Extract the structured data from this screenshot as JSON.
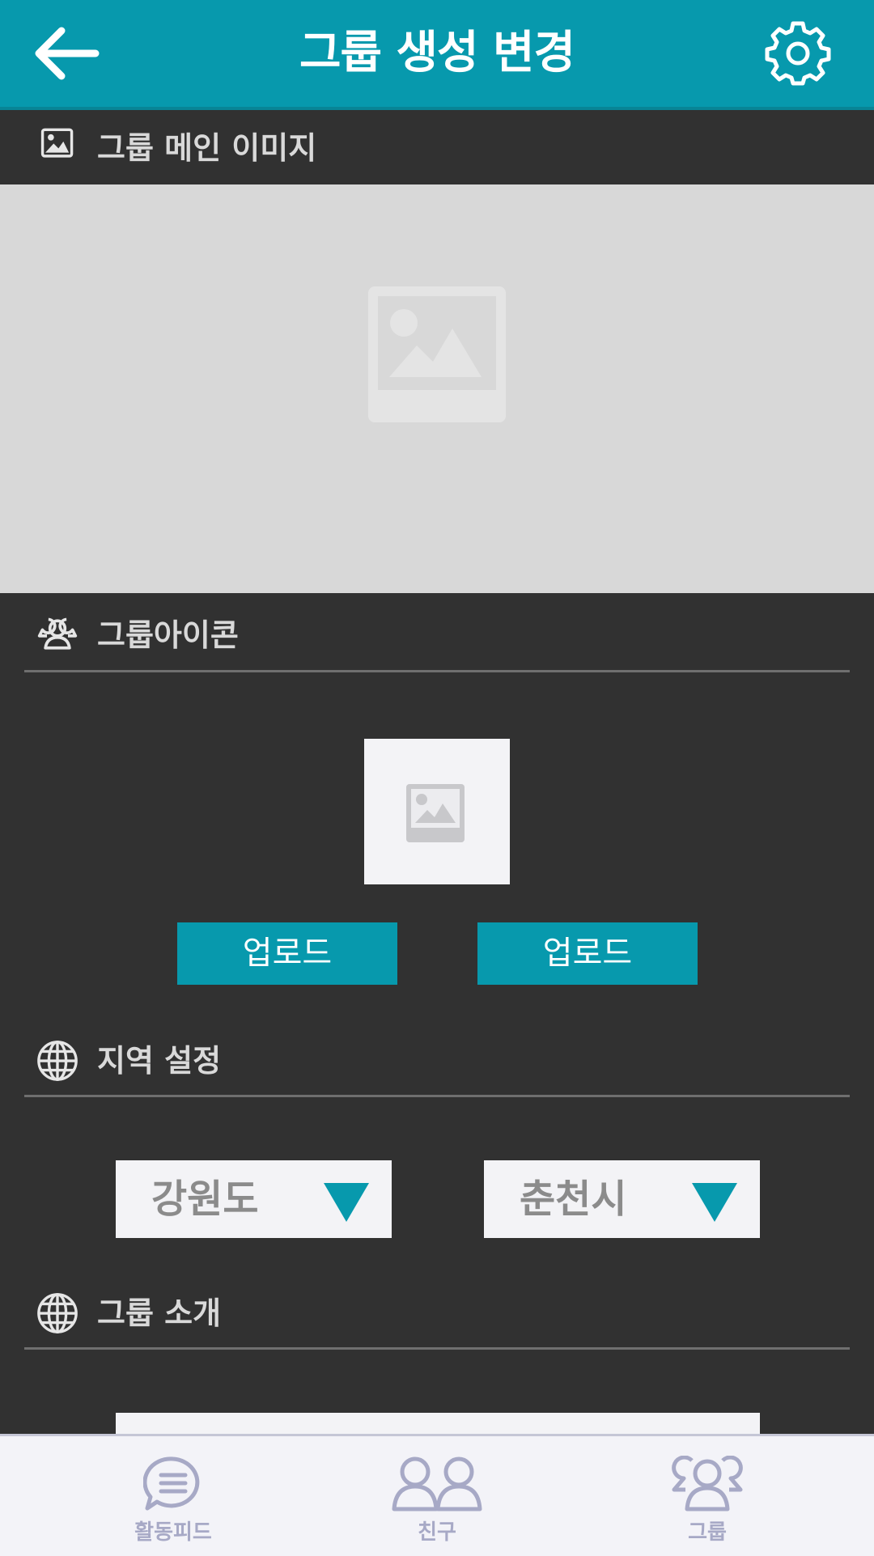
{
  "header": {
    "title": "그룹 생성 변경",
    "back_icon": "arrow-left-icon",
    "settings_icon": "gear-icon",
    "color": "#0799ad"
  },
  "sections": {
    "main_image": {
      "label": "그룹 메인 이미지",
      "icon": "image-icon"
    },
    "group_icon": {
      "label": "그룹아이콘",
      "icon": "group-icon"
    },
    "region": {
      "label": "지역 설정",
      "icon": "globe-icon"
    },
    "intro": {
      "label": "그룹 소개",
      "icon": "globe-icon"
    }
  },
  "uploads": [
    {
      "label": "업로드"
    },
    {
      "label": "업로드"
    }
  ],
  "region": {
    "province": "강원도",
    "city": "춘천시"
  },
  "bottom_nav": {
    "items": [
      {
        "label": "활동피드",
        "icon": "chat-list-icon"
      },
      {
        "label": "친구",
        "icon": "friends-icon"
      },
      {
        "label": "그룹",
        "icon": "group-icon"
      }
    ]
  },
  "colors": {
    "accent": "#0799ad",
    "background": "#313131",
    "nav_tint": "#a7a9c6"
  }
}
